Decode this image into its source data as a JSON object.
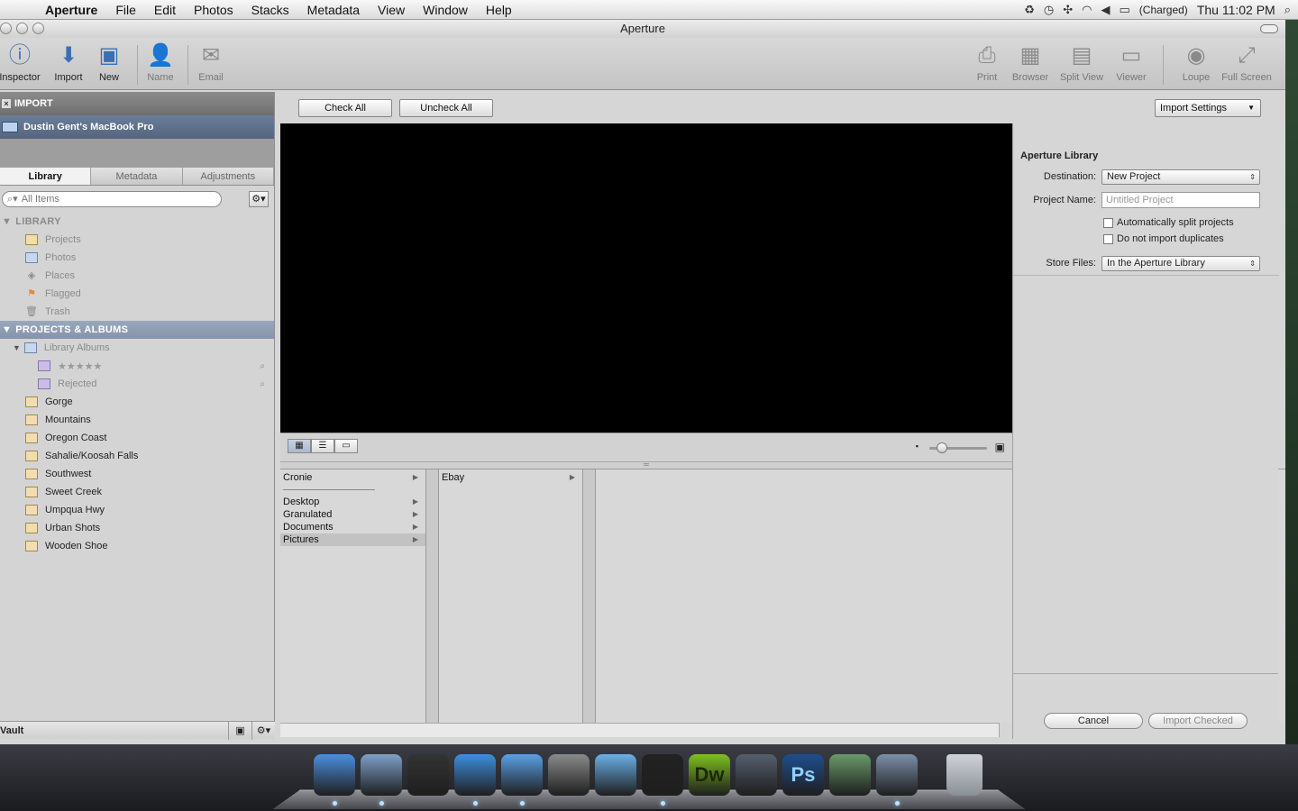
{
  "menubar": {
    "app": "Aperture",
    "menus": [
      "File",
      "Edit",
      "Photos",
      "Stacks",
      "Metadata",
      "View",
      "Window",
      "Help"
    ],
    "battery": "(Charged)",
    "clock": "Thu 11:02 PM"
  },
  "window": {
    "title": "Aperture"
  },
  "toolbar": {
    "left": [
      {
        "label": "Inspector",
        "icon": "info-icon"
      },
      {
        "label": "Import",
        "icon": "import-arrow-icon"
      },
      {
        "label": "New",
        "icon": "new-folder-icon"
      },
      {
        "label": "Name",
        "icon": "name-person-icon"
      },
      {
        "label": "Email",
        "icon": "email-icon"
      }
    ],
    "right": [
      {
        "label": "Print",
        "icon": "printer-icon"
      },
      {
        "label": "Browser",
        "icon": "browser-grid-icon"
      },
      {
        "label": "Split View",
        "icon": "split-view-icon"
      },
      {
        "label": "Viewer",
        "icon": "viewer-icon"
      },
      {
        "label": "Loupe",
        "icon": "loupe-icon"
      },
      {
        "label": "Full Screen",
        "icon": "full-screen-icon"
      }
    ]
  },
  "leftpane": {
    "import_label": "IMPORT",
    "device": "Dustin Gent's MacBook Pro",
    "tabs": [
      "Library",
      "Metadata",
      "Adjustments"
    ],
    "search_placeholder": "All Items",
    "library_header": "LIBRARY",
    "library_items": [
      "Projects",
      "Photos",
      "Places",
      "Flagged",
      "Trash"
    ],
    "projects_header": "PROJECTS & ALBUMS",
    "library_albums": "Library Albums",
    "smart_albums": [
      "★★★★★",
      "Rejected"
    ],
    "projects": [
      "Gorge",
      "Mountains",
      "Oregon Coast",
      "Sahalie/Koosah Falls",
      "Southwest",
      "Sweet Creek",
      "Umpqua Hwy",
      "Urban Shots",
      "Wooden Shoe"
    ],
    "vault": "Vault"
  },
  "center": {
    "check_all": "Check All",
    "uncheck_all": "Uncheck All",
    "import_settings": "Import Settings"
  },
  "browser": {
    "col1_top": "Cronie",
    "col1_items": [
      "Desktop",
      "Granulated",
      "Documents",
      "Pictures"
    ],
    "col1_selected": "Pictures",
    "col2_items": [
      "Ebay"
    ]
  },
  "rightpanel": {
    "title": "Aperture Library",
    "destination_label": "Destination:",
    "destination_value": "New Project",
    "project_name_label": "Project Name:",
    "project_name_placeholder": "Untitled Project",
    "split_projects": "Automatically split projects",
    "no_duplicates": "Do not import duplicates",
    "store_files_label": "Store Files:",
    "store_files_value": "In the Aperture Library",
    "cancel": "Cancel",
    "import_checked": "Import Checked"
  },
  "dock": {
    "apps": [
      {
        "name": "finder-icon",
        "label": "",
        "color": "#4a8fe0"
      },
      {
        "name": "mail-hawk-icon",
        "label": "",
        "color": "#7ea1c9"
      },
      {
        "name": "dashboard-icon",
        "label": "",
        "color": "#333333"
      },
      {
        "name": "safari-icon",
        "label": "",
        "color": "#3d8fe0"
      },
      {
        "name": "itunes-icon",
        "label": "",
        "color": "#5aa0e6"
      },
      {
        "name": "system-preferences-icon",
        "label": "",
        "color": "#8a8a8a"
      },
      {
        "name": "preview-icon",
        "label": "",
        "color": "#6ab0e8"
      },
      {
        "name": "aperture-lens-icon",
        "label": "",
        "color": "#222222"
      },
      {
        "name": "dreamweaver-icon",
        "label": "Dw",
        "color": "#7fbf1e"
      },
      {
        "name": "photo-booth-icon",
        "label": "",
        "color": "#55606d"
      },
      {
        "name": "photoshop-icon",
        "label": "Ps",
        "color": "#1d4f8f"
      },
      {
        "name": "spectacles-icon",
        "label": "",
        "color": "#6a9a6a"
      },
      {
        "name": "iphoto-icon",
        "label": "",
        "color": "#7c8fa8"
      }
    ],
    "trash": "trash-icon"
  }
}
